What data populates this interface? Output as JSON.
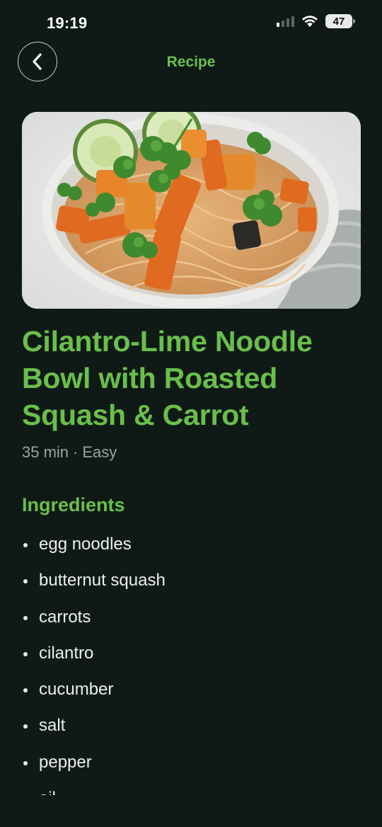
{
  "status_bar": {
    "time": "19:19",
    "battery": "47"
  },
  "nav": {
    "title": "Recipe"
  },
  "recipe": {
    "title": "Cilantro-Lime Noodle Bowl with Roasted Squash & Carrot",
    "duration": "35 min",
    "separator": "·",
    "difficulty": "Easy"
  },
  "ingredients_section": {
    "title": "Ingredients",
    "items": [
      "egg noodles",
      "butternut squash",
      "carrots",
      "cilantro",
      "cucumber",
      "salt",
      "pepper",
      "oil"
    ]
  },
  "colors": {
    "background": "#0f1a16",
    "accent": "#6abf4b",
    "text": "#ecefed",
    "muted": "#9aa39e"
  },
  "icons": [
    "chevron-left-icon",
    "signal-icon",
    "wifi-icon",
    "battery-icon"
  ]
}
